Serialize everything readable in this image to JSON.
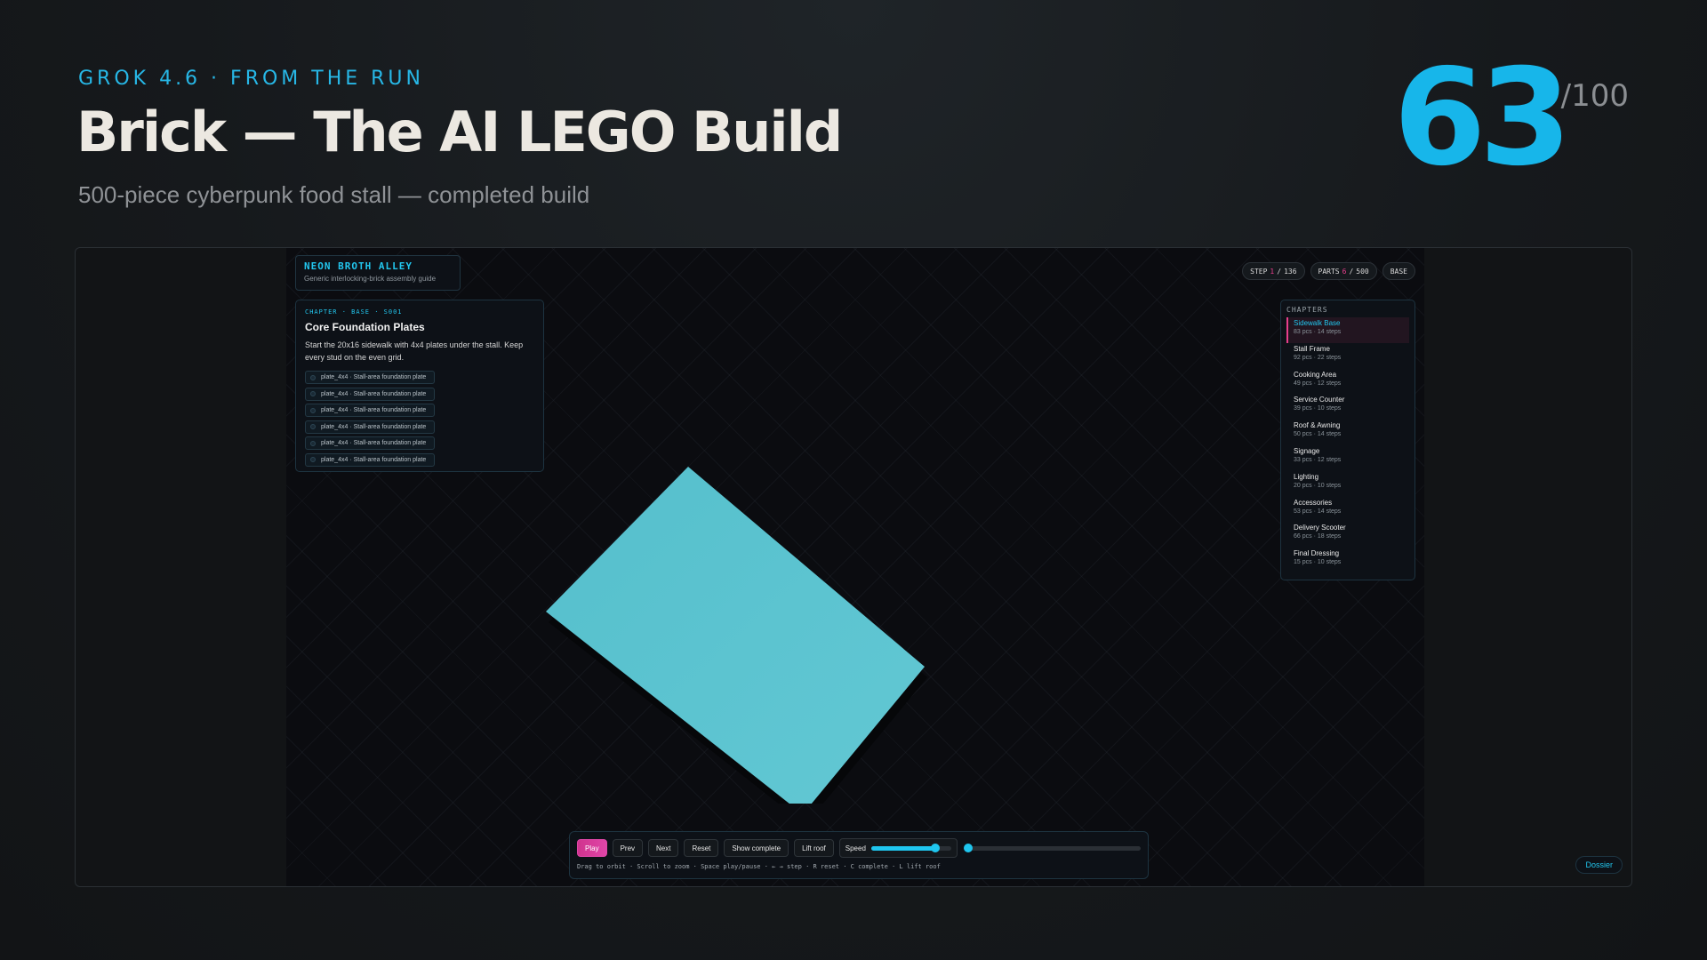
{
  "header": {
    "eyebrow": "GROK 4.6 · FROM THE RUN",
    "title": "Brick — The AI LEGO Build",
    "subtitle": "500-piece cyberpunk food stall — completed build",
    "score": "63",
    "score_max": "/100"
  },
  "app": {
    "brand": {
      "name": "NEON BROTH ALLEY",
      "tagline": "Generic interlocking-brick assembly guide"
    },
    "step_panel": {
      "meta": "CHAPTER · BASE · S001",
      "title": "Core Foundation Plates",
      "description": "Start the 20x16 sidewalk with 4x4 plates under the stall. Keep every stud on the even grid.",
      "parts": [
        "plate_4x4 · Stall-area foundation plate",
        "plate_4x4 · Stall-area foundation plate",
        "plate_4x4 · Stall-area foundation plate",
        "plate_4x4 · Stall-area foundation plate",
        "plate_4x4 · Stall-area foundation plate",
        "plate_4x4 · Stall-area foundation plate"
      ]
    },
    "status": {
      "step_label": "STEP",
      "step_current": "1",
      "step_sep": "/",
      "step_total": "136",
      "parts_label": "PARTS",
      "parts_current": "6",
      "parts_sep": "/",
      "parts_total": "500",
      "mode": "BASE"
    },
    "chapters": {
      "heading": "CHAPTERS",
      "items": [
        {
          "name": "Sidewalk Base",
          "info": "83 pcs · 14 steps"
        },
        {
          "name": "Stall Frame",
          "info": "92 pcs · 22 steps"
        },
        {
          "name": "Cooking Area",
          "info": "49 pcs · 12 steps"
        },
        {
          "name": "Service Counter",
          "info": "39 pcs · 10 steps"
        },
        {
          "name": "Roof & Awning",
          "info": "50 pcs · 14 steps"
        },
        {
          "name": "Signage",
          "info": "33 pcs · 12 steps"
        },
        {
          "name": "Lighting",
          "info": "20 pcs · 10 steps"
        },
        {
          "name": "Accessories",
          "info": "53 pcs · 14 steps"
        },
        {
          "name": "Delivery Scooter",
          "info": "66 pcs · 18 steps"
        },
        {
          "name": "Final Dressing",
          "info": "15 pcs · 10 steps"
        }
      ]
    },
    "controls": {
      "play": "Play",
      "prev": "Prev",
      "next": "Next",
      "reset": "Reset",
      "show_complete": "Show complete",
      "lift_roof": "Lift roof",
      "speed_label": "Speed",
      "speed_level": 0.8,
      "progress_level": 0.0,
      "hint": "Drag to orbit · Scroll to zoom · Space play/pause · ← → step · R reset · C complete · L lift roof"
    },
    "dossier": "Dossier"
  },
  "colors": {
    "accent": "#17b6ea",
    "highlight": "#e83e8c",
    "plate": "#5cc4d0"
  }
}
